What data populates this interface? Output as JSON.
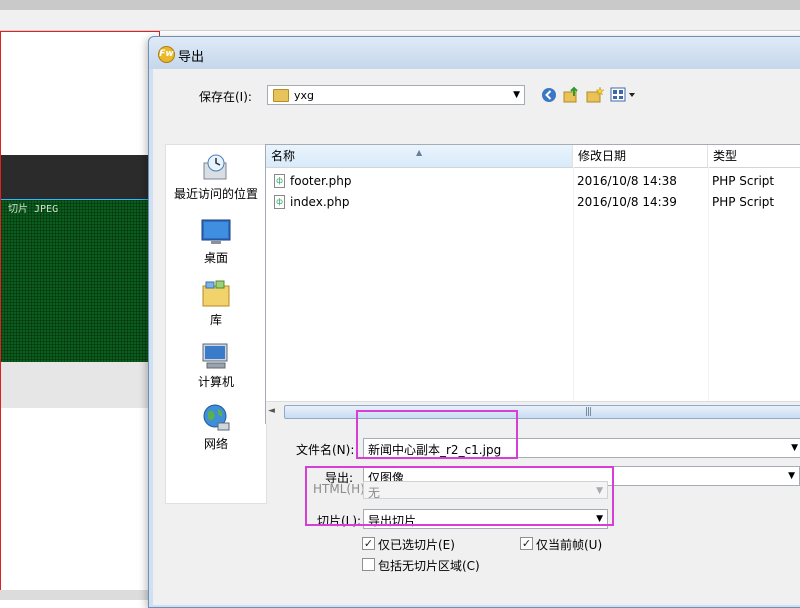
{
  "background": {
    "slice_label": "切片 JPEG"
  },
  "dialog": {
    "title": "导出",
    "title_icon_glyph": "Fw",
    "save_in": {
      "label": "保存在(I):",
      "value": "yxg"
    },
    "toolbar_icons": [
      "back-icon",
      "up-folder-icon",
      "new-folder-icon",
      "view-menu-icon"
    ],
    "places": [
      {
        "id": "recent",
        "label": "最近访问的位置",
        "icon": "recent-places-icon"
      },
      {
        "id": "desktop",
        "label": "桌面",
        "icon": "desktop-icon"
      },
      {
        "id": "libraries",
        "label": "库",
        "icon": "libraries-icon"
      },
      {
        "id": "computer",
        "label": "计算机",
        "icon": "computer-icon"
      },
      {
        "id": "network",
        "label": "网络",
        "icon": "network-icon"
      }
    ],
    "file_list": {
      "columns": {
        "name": "名称",
        "date": "修改日期",
        "type": "类型"
      },
      "files": [
        {
          "name": "footer.php",
          "date": "2016/10/8 14:38",
          "type": "PHP Script"
        },
        {
          "name": "index.php",
          "date": "2016/10/8 14:39",
          "type": "PHP Script"
        }
      ]
    },
    "filename": {
      "label": "文件名(N):",
      "value": "新闻中心副本_r2_c1.jpg"
    },
    "export": {
      "label": "导出:",
      "value": "仅图像"
    },
    "html": {
      "label": "HTML(H):",
      "value": "无"
    },
    "slices": {
      "label": "切片(L):",
      "value": "导出切片"
    },
    "options": [
      {
        "label": "仅已选切片(E)",
        "checked": true
      },
      {
        "label": "仅当前帧(U)",
        "checked": true
      },
      {
        "label": "包括无切片区域(C)",
        "checked": false
      }
    ],
    "annotation_color": "#d63fd6"
  }
}
